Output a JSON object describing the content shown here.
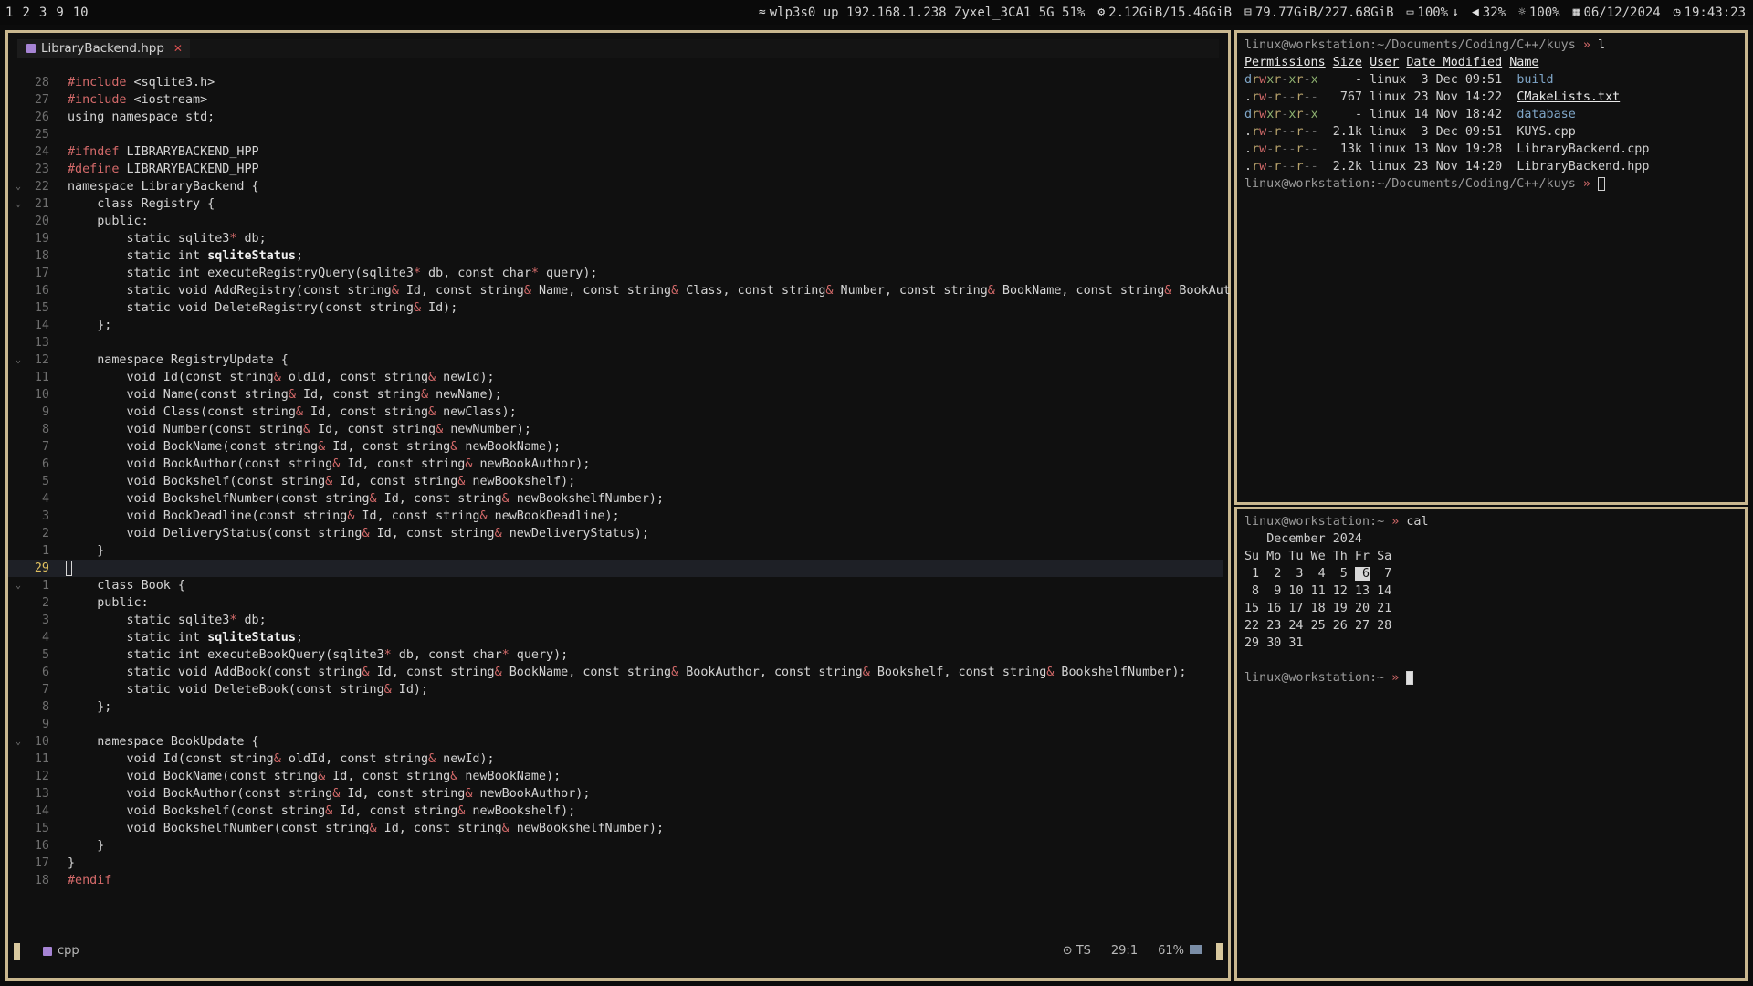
{
  "topbar": {
    "workspaces": [
      "1",
      "2",
      "3",
      "9",
      "10"
    ],
    "network": "wlp3s0 up 192.168.1.238 Zyxel_3CA1 5G 51%",
    "memory": "2.12GiB/15.46GiB",
    "disk": "79.77GiB/227.68GiB",
    "battery": "100%",
    "volume": "32%",
    "brightness": "100%",
    "date": "06/12/2024",
    "time": "19:43:23",
    "icons": {
      "wifi": "wifi-icon",
      "cpu": "cpu-icon",
      "disk": "disk-icon",
      "battery": "battery-icon",
      "volume": "volume-icon",
      "brightness": "brightness-icon",
      "calendar": "calendar-icon",
      "clock": "clock-icon"
    }
  },
  "editor": {
    "tab_label": "LibraryBackend.hpp",
    "filetype": "cpp",
    "ts_label": "TS",
    "position": "29:1",
    "percent": "61%",
    "lines": [
      {
        "num": "28",
        "text": "#include <sqlite3.h>"
      },
      {
        "num": "27",
        "text": "#include <iostream>"
      },
      {
        "num": "26",
        "text": "using namespace std;"
      },
      {
        "num": "25",
        "text": ""
      },
      {
        "num": "24",
        "text": "#ifndef LIBRARYBACKEND_HPP"
      },
      {
        "num": "23",
        "text": "#define LIBRARYBACKEND_HPP"
      },
      {
        "num": "22",
        "text": "namespace LibraryBackend {",
        "fold": true
      },
      {
        "num": "21",
        "text": "    class Registry {",
        "fold": true
      },
      {
        "num": "20",
        "text": "    public:"
      },
      {
        "num": "19",
        "text": "        static sqlite3* db;"
      },
      {
        "num": "18",
        "text": "        static int sqliteStatus;"
      },
      {
        "num": "17",
        "text": "        static int executeRegistryQuery(sqlite3* db, const char* query);"
      },
      {
        "num": "16",
        "text": "        static void AddRegistry(const string& Id, const string& Name, const string& Class, const string& Number, const string& BookName, const string& BookAut"
      },
      {
        "num": "15",
        "text": "        static void DeleteRegistry(const string& Id);"
      },
      {
        "num": "14",
        "text": "    };"
      },
      {
        "num": "13",
        "text": ""
      },
      {
        "num": "12",
        "text": "    namespace RegistryUpdate {",
        "fold": true
      },
      {
        "num": "11",
        "text": "        void Id(const string& oldId, const string& newId);"
      },
      {
        "num": "10",
        "text": "        void Name(const string& Id, const string& newName);"
      },
      {
        "num": "9",
        "text": "        void Class(const string& Id, const string& newClass);"
      },
      {
        "num": "8",
        "text": "        void Number(const string& Id, const string& newNumber);"
      },
      {
        "num": "7",
        "text": "        void BookName(const string& Id, const string& newBookName);"
      },
      {
        "num": "6",
        "text": "        void BookAuthor(const string& Id, const string& newBookAuthor);"
      },
      {
        "num": "5",
        "text": "        void Bookshelf(const string& Id, const string& newBookshelf);"
      },
      {
        "num": "4",
        "text": "        void BookshelfNumber(const string& Id, const string& newBookshelfNumber);"
      },
      {
        "num": "3",
        "text": "        void BookDeadline(const string& Id, const string& newBookDeadline);"
      },
      {
        "num": "2",
        "text": "        void DeliveryStatus(const string& Id, const string& newDeliveryStatus);"
      },
      {
        "num": "1",
        "text": "    }"
      },
      {
        "num": "29",
        "text": "",
        "current": true
      },
      {
        "num": "1",
        "text": "    class Book {",
        "fold": true
      },
      {
        "num": "2",
        "text": "    public:"
      },
      {
        "num": "3",
        "text": "        static sqlite3* db;"
      },
      {
        "num": "4",
        "text": "        static int sqliteStatus;"
      },
      {
        "num": "5",
        "text": "        static int executeBookQuery(sqlite3* db, const char* query);"
      },
      {
        "num": "6",
        "text": "        static void AddBook(const string& Id, const string& BookName, const string& BookAuthor, const string& Bookshelf, const string& BookshelfNumber);"
      },
      {
        "num": "7",
        "text": "        static void DeleteBook(const string& Id);"
      },
      {
        "num": "8",
        "text": "    };"
      },
      {
        "num": "9",
        "text": ""
      },
      {
        "num": "10",
        "text": "    namespace BookUpdate {",
        "fold": true
      },
      {
        "num": "11",
        "text": "        void Id(const string& oldId, const string& newId);"
      },
      {
        "num": "12",
        "text": "        void BookName(const string& Id, const string& newBookName);"
      },
      {
        "num": "13",
        "text": "        void BookAuthor(const string& Id, const string& newBookAuthor);"
      },
      {
        "num": "14",
        "text": "        void Bookshelf(const string& Id, const string& newBookshelf);"
      },
      {
        "num": "15",
        "text": "        void BookshelfNumber(const string& Id, const string& newBookshelfNumber);"
      },
      {
        "num": "16",
        "text": "    }"
      },
      {
        "num": "17",
        "text": "}"
      },
      {
        "num": "18",
        "text": "#endif"
      }
    ]
  },
  "term1": {
    "user": "linux",
    "host": "workstation",
    "cwd": "~/Documents/Coding/C++/kuys",
    "command": "l",
    "headers": [
      "Permissions",
      "Size",
      "User",
      "Date Modified",
      "Name"
    ],
    "rows": [
      {
        "perm": "drwxr-xr-x",
        "size": "-",
        "user": "linux",
        "date": "3 Dec 09:51",
        "name": "build",
        "kind": "dir"
      },
      {
        "perm": ".rw-r--r--",
        "size": "767",
        "user": "linux",
        "date": "23 Nov 14:22",
        "name": "CMakeLists.txt",
        "kind": "special"
      },
      {
        "perm": "drwxr-xr-x",
        "size": "-",
        "user": "linux",
        "date": "14 Nov 18:42",
        "name": "database",
        "kind": "dir"
      },
      {
        "perm": ".rw-r--r--",
        "size": "2.1k",
        "user": "linux",
        "date": "3 Dec 09:51",
        "name": "KUYS.cpp",
        "kind": "file"
      },
      {
        "perm": ".rw-r--r--",
        "size": "13k",
        "user": "linux",
        "date": "13 Nov 19:28",
        "name": "LibraryBackend.cpp",
        "kind": "file"
      },
      {
        "perm": ".rw-r--r--",
        "size": "2.2k",
        "user": "linux",
        "date": "23 Nov 14:20",
        "name": "LibraryBackend.hpp",
        "kind": "file"
      }
    ]
  },
  "term2": {
    "user": "linux",
    "host": "workstation",
    "cwd": "~",
    "command": "cal",
    "cal_title": "December 2024",
    "cal_header": "Su Mo Tu We Th Fr Sa",
    "cal_weeks": [
      [
        " 1",
        " 2",
        " 3",
        " 4",
        " 5",
        " 6",
        " 7"
      ],
      [
        " 8",
        " 9",
        "10",
        "11",
        "12",
        "13",
        "14"
      ],
      [
        "15",
        "16",
        "17",
        "18",
        "19",
        "20",
        "21"
      ],
      [
        "22",
        "23",
        "24",
        "25",
        "26",
        "27",
        "28"
      ],
      [
        "29",
        "30",
        "31"
      ]
    ],
    "today": "6"
  }
}
